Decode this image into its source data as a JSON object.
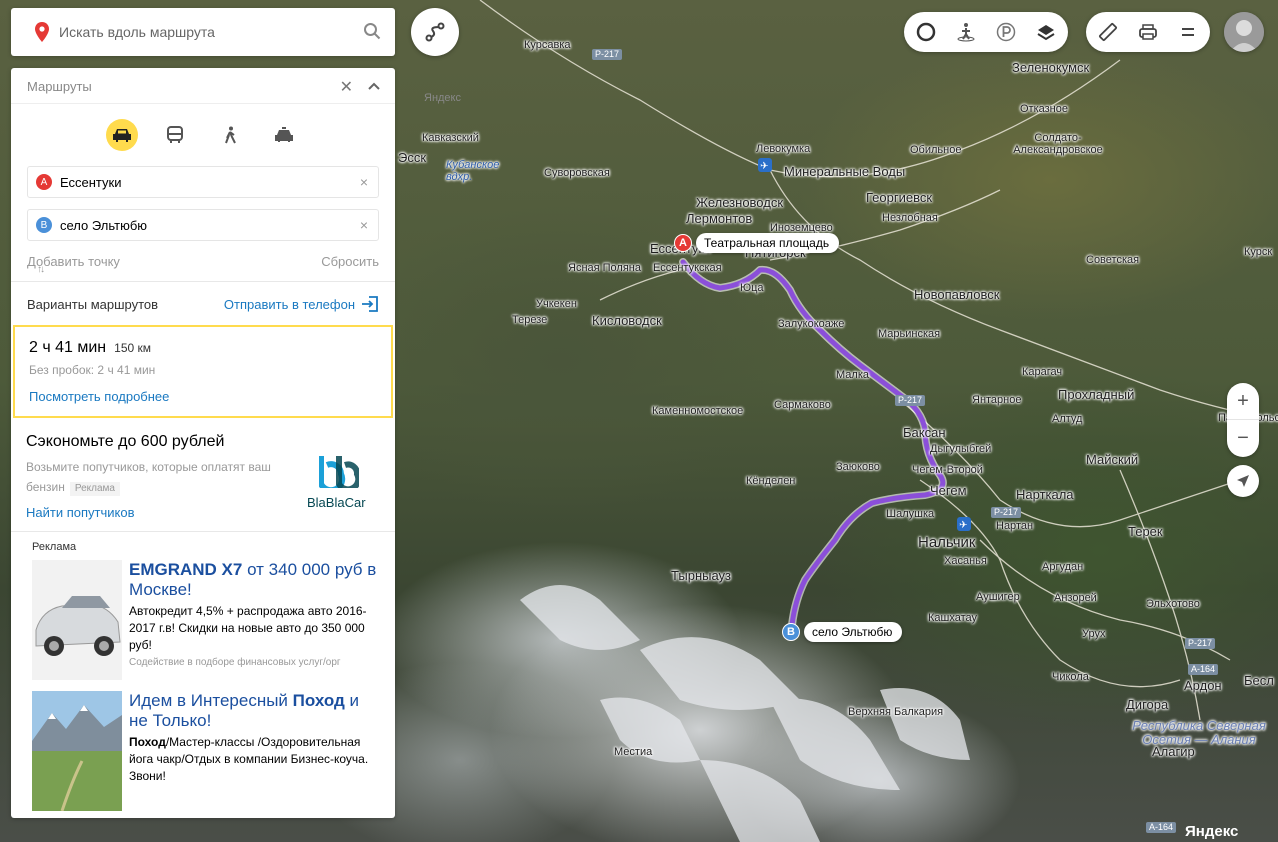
{
  "search": {
    "placeholder": "Искать вдоль маршрута"
  },
  "routes_panel": {
    "title": "Маршруты",
    "modes": [
      "car-icon",
      "bus-icon",
      "walk-icon",
      "taxi-icon"
    ],
    "waypoint_a": {
      "letter": "A",
      "value": "Ессентуки"
    },
    "waypoint_b": {
      "letter": "B",
      "value": "село Эльтюбю"
    },
    "add_point": "Добавить точку",
    "reset": "Сбросить",
    "variants_label": "Варианты маршрутов",
    "send_to_phone": "Отправить в телефон",
    "route": {
      "time": "2 ч 41 мин",
      "distance": "150 км",
      "no_traffic": "Без пробок: 2 ч 41 мин",
      "details_link": "Посмотреть подробнее"
    },
    "promo": {
      "title": "Сэкономьте до 600 рублей",
      "text": "Возьмите попутчиков, которые оплатят ваш бензин",
      "badge": "Реклама",
      "link": "Найти попутчиков",
      "brand": "BlaBlaCar"
    },
    "ads_label": "Реклама",
    "ads": [
      {
        "headline_bold": "EMGRAND X7",
        "headline_rest": " от 340 000 руб в Москве!",
        "text": "Автокредит 4,5% + распродажа авто 2016-2017 г.в! Скидки на новые авто до 350 000 руб!",
        "source": "Содействие в подборе финансовых услуг/орг"
      },
      {
        "headline_pre": "Идем в Интересный ",
        "headline_bold": "Поход",
        "headline_post": " и не Только!",
        "text_bold": "Поход",
        "text": "/Мастер-классы /Оздоровительная йога чакр/Отдых в компании Бизнес-коуча. Звони!"
      }
    ]
  },
  "map": {
    "route_color": "#8b4fd9",
    "pin_a": {
      "letter": "A",
      "label": "Театральная площадь",
      "color": "#e53935"
    },
    "pin_b": {
      "letter": "B",
      "label": "село Эльтюбю",
      "color": "#4a90d9"
    },
    "places": [
      "Курсавка",
      "Левокумка",
      "Минеральные Воды",
      "Железноводск",
      "Лермонтов",
      "Иноземцево",
      "Ессентуки",
      "Пятигорск",
      "Ессентукская",
      "Юца",
      "Ясная Поляна",
      "Кисловодск",
      "Учкекен",
      "Терезе",
      "Залукокоаже",
      "Малка",
      "Сармаково",
      "Каменномостское",
      "Кавказский",
      "Суворовская",
      "Кубанское вдхр.",
      "Георгиевск",
      "Незлобная",
      "Обильное",
      "Отказное",
      "Зеленокумск",
      "Солдато-Александровское",
      "Новопавловск",
      "Советская",
      "Марьинская",
      "Карагач",
      "Прохладный",
      "Янтарное",
      "Алтуд",
      "Баксан",
      "Дыгулыбгей",
      "Чегем-Второй",
      "Чегем",
      "Заюково",
      "Кёнделен",
      "Шалушка",
      "Нальчик",
      "Нартан",
      "Нарткала",
      "Майский",
      "Терек",
      "Хасанья",
      "Аргудан",
      "Тырныауз",
      "Аушигер",
      "Анзорей",
      "Кашхатау",
      "Урух",
      "Эльхотово",
      "Чикола",
      "Дигора",
      "Ардон",
      "Алагир",
      "Верхняя Балкария",
      "Местиа",
      "Республика Северная Осетия — Алания",
      "Павлодольская",
      "Курск",
      "Бесл",
      "Эссентуки",
      "Нижний",
      "Яндекс",
      "Эсск",
      "Ессентукская",
      "Кисловодск"
    ],
    "roads": [
      "Р-217",
      "Р-217",
      "Р-217",
      "Р-217",
      "А-164",
      "А-164"
    ],
    "watermark": "Яндекс"
  },
  "controls": {
    "zoom_in": "+",
    "zoom_out": "−"
  }
}
